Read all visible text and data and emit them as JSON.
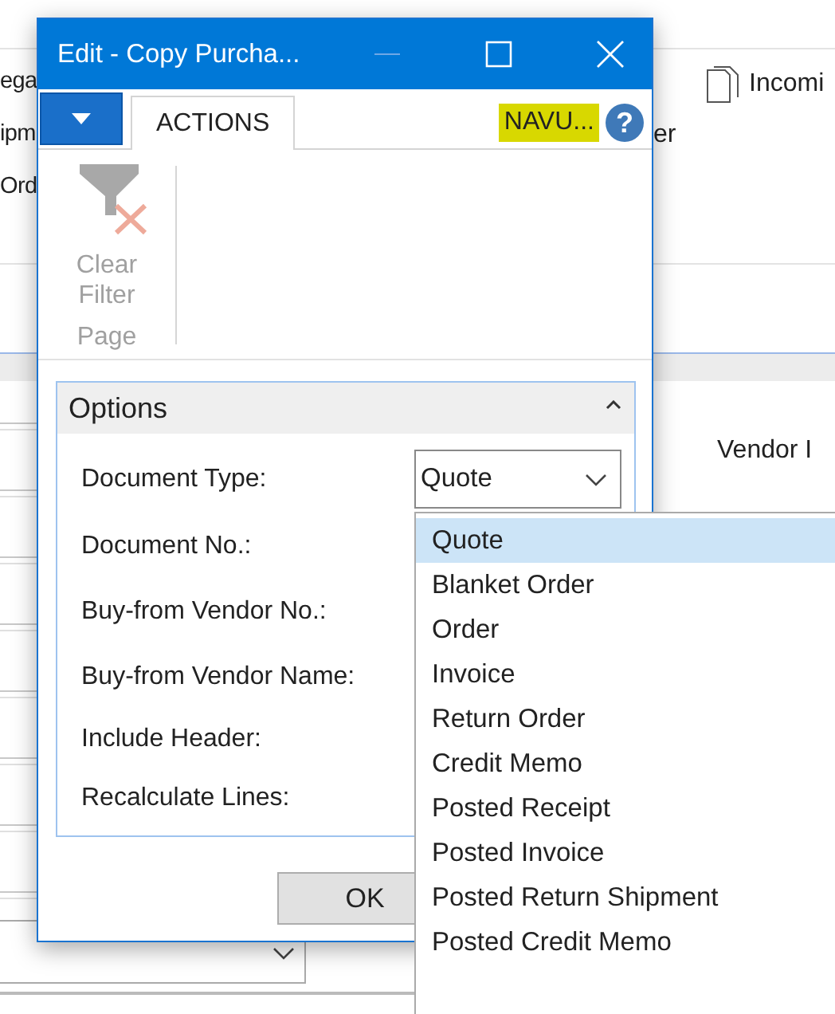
{
  "background": {
    "left_texts": [
      "ega",
      "ipm",
      "Ord"
    ],
    "shortcut": {
      "label": "Incomi"
    },
    "side_text": "er",
    "field_label": "Vendor I"
  },
  "dialog": {
    "title": "Edit - Copy Purcha...",
    "ribbon": {
      "tabs": [
        {
          "label": "ACTIONS",
          "selected": true
        }
      ],
      "nav_label": "NAVU...",
      "help": "?",
      "actions": [
        {
          "label": "Clear Filter",
          "disabled": true
        }
      ],
      "group": "Page"
    },
    "options": {
      "title": "Options",
      "expanded": true,
      "fields": [
        {
          "label": "Document Type:",
          "kind": "select",
          "value": "Quote"
        },
        {
          "label": "Document No.:",
          "kind": "blank"
        },
        {
          "label": "Buy-from Vendor No.:",
          "kind": "blank"
        },
        {
          "label": "Buy-from Vendor Name:",
          "kind": "blank"
        },
        {
          "label": "Include Header:",
          "kind": "blank"
        },
        {
          "label": "Recalculate Lines:",
          "kind": "blank"
        }
      ]
    },
    "buttons": [
      "OK"
    ]
  },
  "dropdown": {
    "items": [
      {
        "label": "Quote",
        "selected": true
      },
      {
        "label": "Blanket Order",
        "selected": false
      },
      {
        "label": "Order",
        "selected": false
      },
      {
        "label": "Invoice",
        "selected": false
      },
      {
        "label": "Return Order",
        "selected": false
      },
      {
        "label": "Credit Memo",
        "selected": false
      },
      {
        "label": "Posted Receipt",
        "selected": false
      },
      {
        "label": "Posted Invoice",
        "selected": false
      },
      {
        "label": "Posted Return Shipment",
        "selected": false
      },
      {
        "label": "Posted Credit Memo",
        "selected": false
      }
    ]
  }
}
